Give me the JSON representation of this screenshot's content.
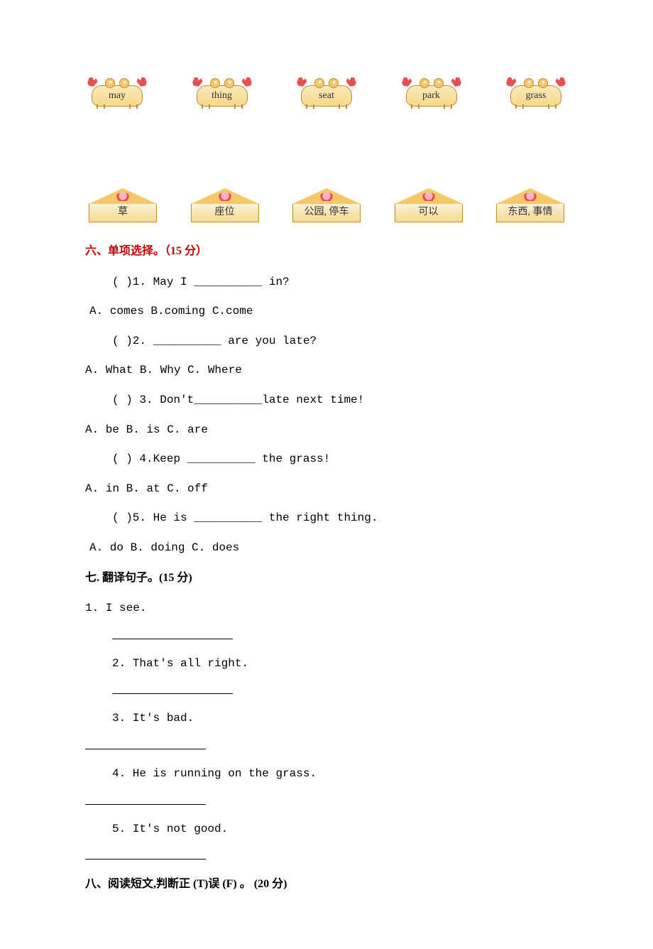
{
  "crabs": {
    "c0": "may",
    "c1": "thing",
    "c2": "seat",
    "c3": "park",
    "c4": "grass"
  },
  "houses": {
    "h0": "草",
    "h1": "座位",
    "h2": "公园, 停车",
    "h3": "可以",
    "h4": "东西, 事情"
  },
  "section6_title": "六、单项选择。（15 分）",
  "section6": {
    "q1": "(    )1. May I __________ in?",
    "o1": "A. comes    B.coming    C.come",
    "q2": "(    )2. __________ are you late?",
    "o2": "A. What    B. Why    C. Where",
    "q3": "(    ) 3. Don't__________late next time!",
    "o3": "A. be    B. is    C. are",
    "q4": "(    ) 4.Keep __________ the grass!",
    "o4": "A. in    B. at    C. off",
    "q5": "(    )5. He is __________ the right thing.",
    "o5": "A. do    B. doing    C. does"
  },
  "section7_title": "七. 翻译句子。(15 分)",
  "section7": {
    "t1": "1. I see.",
    "t2": "2. That's all right.",
    "t3": "3. It's bad.",
    "t4": "4. He is running on the grass.",
    "t5": "5. It's not good."
  },
  "section8_title": "八、阅读短文,判断正 (T)误 (F) 。  (20 分)"
}
